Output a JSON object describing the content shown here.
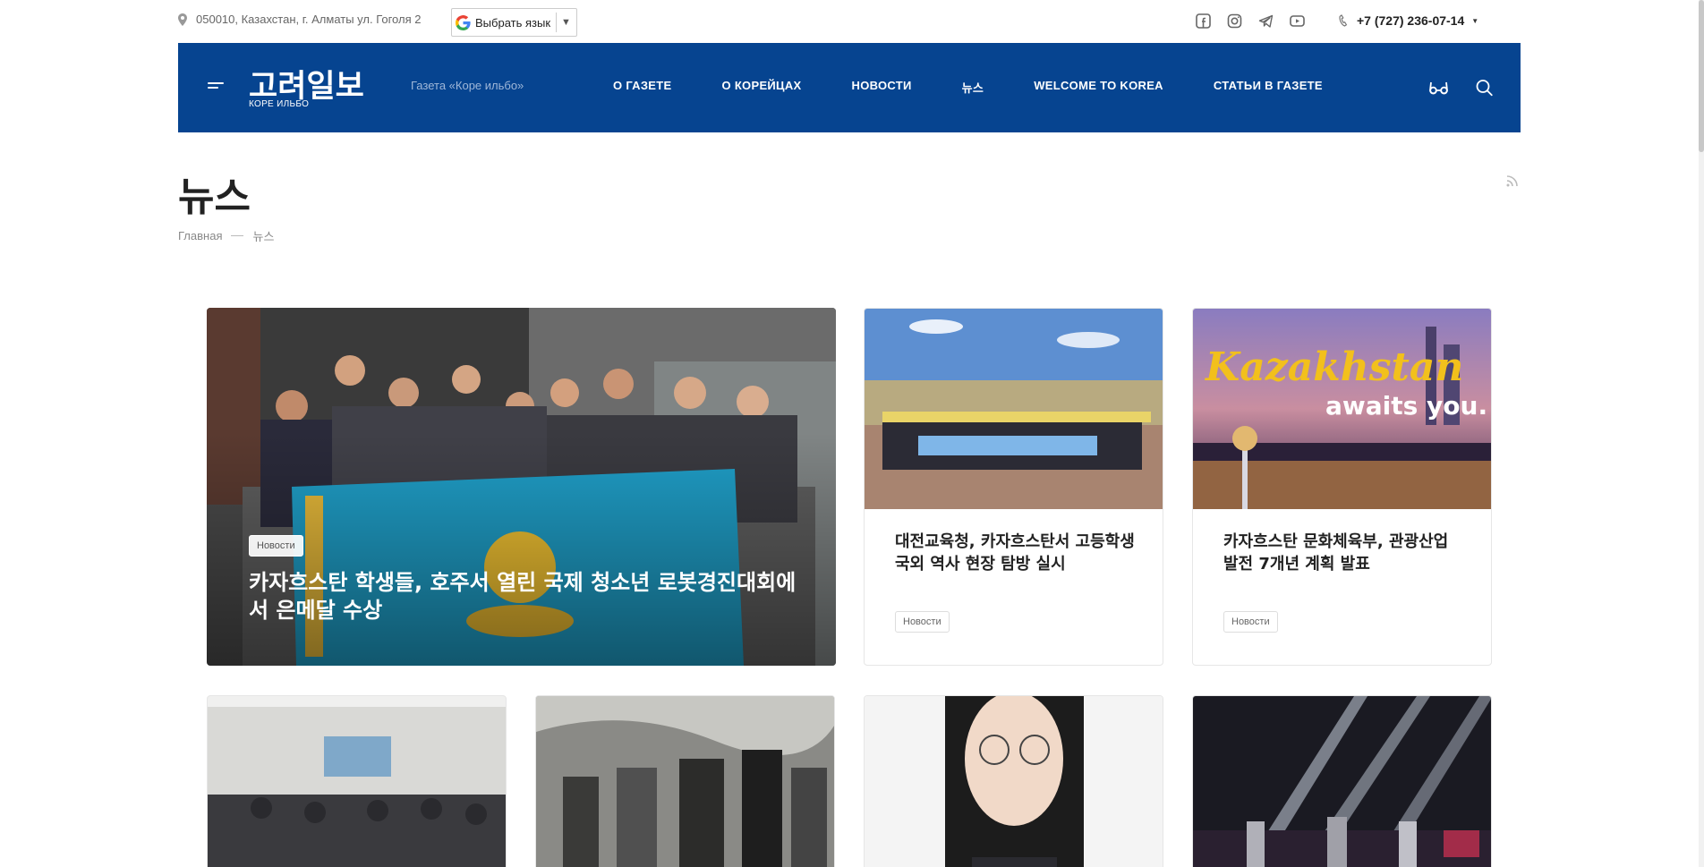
{
  "topbar": {
    "address": "050010, Казахстан, г. Алматы ул. Гоголя 2",
    "translate_label": "Выбрать язык",
    "phone": "+7 (727) 236-07-14",
    "socials": [
      "facebook-icon",
      "instagram-icon",
      "telegram-icon",
      "youtube-icon"
    ]
  },
  "header": {
    "logo_main": "고려일보",
    "logo_sub": "КОРЕ ИЛЬБО",
    "tagline": "Газета «Коре ильбо»",
    "nav": [
      {
        "label": "О ГАЗЕТЕ"
      },
      {
        "label": "О КОРЕЙЦАХ"
      },
      {
        "label": "НОВОСТИ"
      },
      {
        "label": "뉴스"
      },
      {
        "label": "WELCOME TO KOREA"
      },
      {
        "label": "СТАТЬИ В ГАЗЕТЕ"
      }
    ],
    "bg_color": "#064490"
  },
  "page": {
    "title": "뉴스",
    "breadcrumb": [
      "Главная",
      "뉴스"
    ]
  },
  "featured": {
    "tag": "Новости",
    "title": "카자흐스탄 학생들, 호주서 열린 국제 청소년 로봇경진대회에서 은메달 수상"
  },
  "cards": [
    {
      "title": "대전교육청, 카자흐스탄서 고등학생 국외 역사 현장 탐방 실시",
      "tag": "Новости"
    },
    {
      "title": "카자흐스탄 문화체육부, 관광산업 발전 7개년 계획 발표",
      "tag": "Новости",
      "image_text_1": "Kazakhstan",
      "image_text_2": "awaits you."
    }
  ]
}
